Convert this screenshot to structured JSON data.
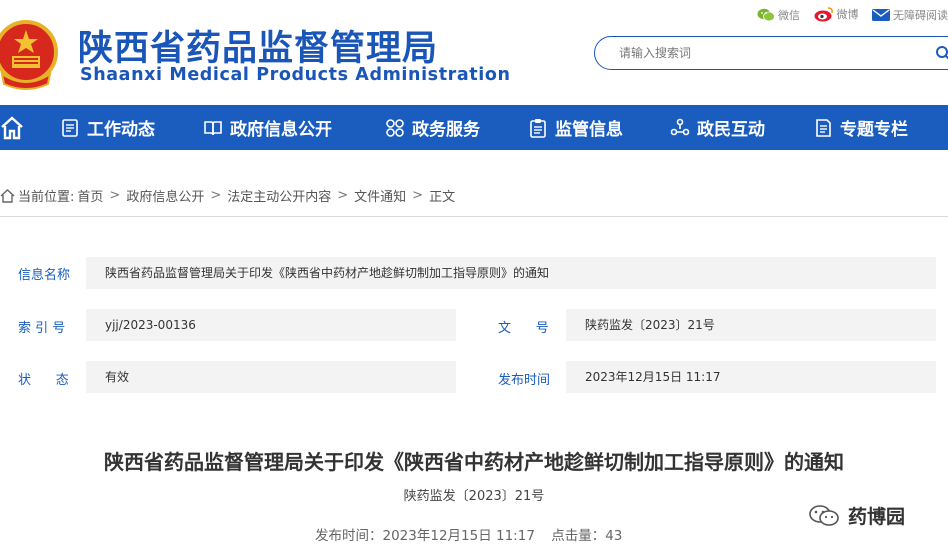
{
  "site": {
    "title_cn": "陕西省药品监督管理局",
    "title_en": "Shaanxi Medical Products Administration"
  },
  "top_links": [
    {
      "label": "微信",
      "icon": "wechat-icon",
      "color": "#7bb32e"
    },
    {
      "label": "微博",
      "icon": "weibo-icon",
      "color": "#e6162d"
    },
    {
      "label": "无障碍阅读",
      "icon": "mail-icon",
      "color": "#1a5dbf"
    }
  ],
  "search": {
    "placeholder": "请输入搜索词",
    "icon": "search-icon"
  },
  "nav": {
    "home_icon": "home-icon",
    "items": [
      {
        "label": "工作动态",
        "icon": "document-icon"
      },
      {
        "label": "政府信息公开",
        "icon": "book-icon"
      },
      {
        "label": "政务服务",
        "icon": "grid-icon"
      },
      {
        "label": "监管信息",
        "icon": "clipboard-icon"
      },
      {
        "label": "政民互动",
        "icon": "interaction-icon"
      },
      {
        "label": "专题专栏",
        "icon": "notebook-icon"
      }
    ]
  },
  "breadcrumb": {
    "prefix": "当前位置:",
    "items": [
      "首页",
      "政府信息公开",
      "法定主动公开内容",
      "文件通知",
      "正文"
    ],
    "separator": ">"
  },
  "info": {
    "name_label": "信息名称",
    "name_value": "陕西省药品监督管理局关于印发《陕西省中药材产地趁鲜切制加工指导原则》的通知",
    "index_label": "索 引 号",
    "index_value": "yjj/2023-00136",
    "docno_label": "文      号",
    "docno_value": "陕药监发〔2023〕21号",
    "status_label": "状      态",
    "status_value": "有效",
    "date_label": "发布时间",
    "date_value": "2023年12月15日 11:17"
  },
  "article": {
    "title": "陕西省药品监督管理局关于印发《陕西省中药材产地趁鲜切制加工指导原则》的通知",
    "doc_number": "陕药监发〔2023〕21号",
    "publish_label": "发布时间：",
    "publish_time": "2023年12月15日 11:17",
    "clicks_label": "点击量：",
    "clicks": "43"
  },
  "watermark": {
    "text": "药博园"
  },
  "colors": {
    "brand": "#1a5dbf",
    "label": "#1a5dbf",
    "value_bg": "#f3f3f3"
  }
}
